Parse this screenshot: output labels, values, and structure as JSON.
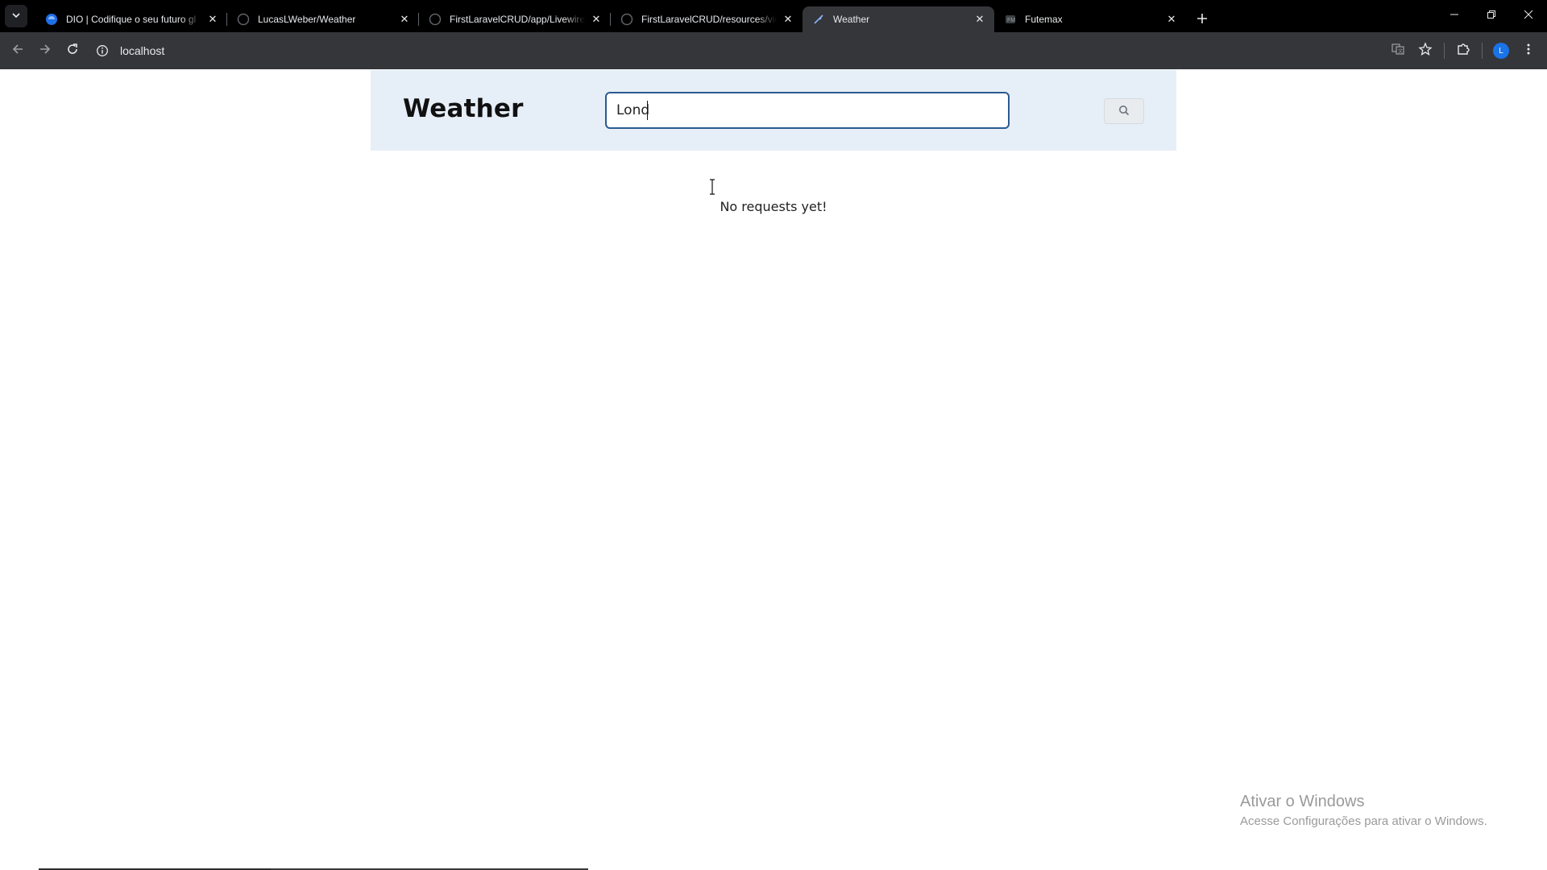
{
  "browser": {
    "tabs": [
      {
        "title": "DIO | Codifique o seu futuro gl",
        "icon": "dio-icon",
        "active": false
      },
      {
        "title": "LucasLWeber/Weather",
        "icon": "github-icon",
        "active": false
      },
      {
        "title": "FirstLaravelCRUD/app/Livewire/",
        "icon": "github-icon",
        "active": false
      },
      {
        "title": "FirstLaravelCRUD/resources/vie",
        "icon": "github-icon",
        "active": false
      },
      {
        "title": "Weather",
        "icon": "feather-icon",
        "active": true
      },
      {
        "title": "Futemax",
        "icon": "futemax-icon",
        "active": false
      }
    ],
    "address": "localhost",
    "avatar_letter": "L",
    "accent": "#1a73e8"
  },
  "page": {
    "title": "Weather",
    "search": {
      "value": "Lond"
    },
    "empty_message": "No requests yet!",
    "header_bg": "#e6eef7",
    "input_border": "#2b5a8f"
  },
  "watermark": {
    "title": "Ativar o Windows",
    "subtitle": "Acesse Configurações para ativar o Windows."
  }
}
